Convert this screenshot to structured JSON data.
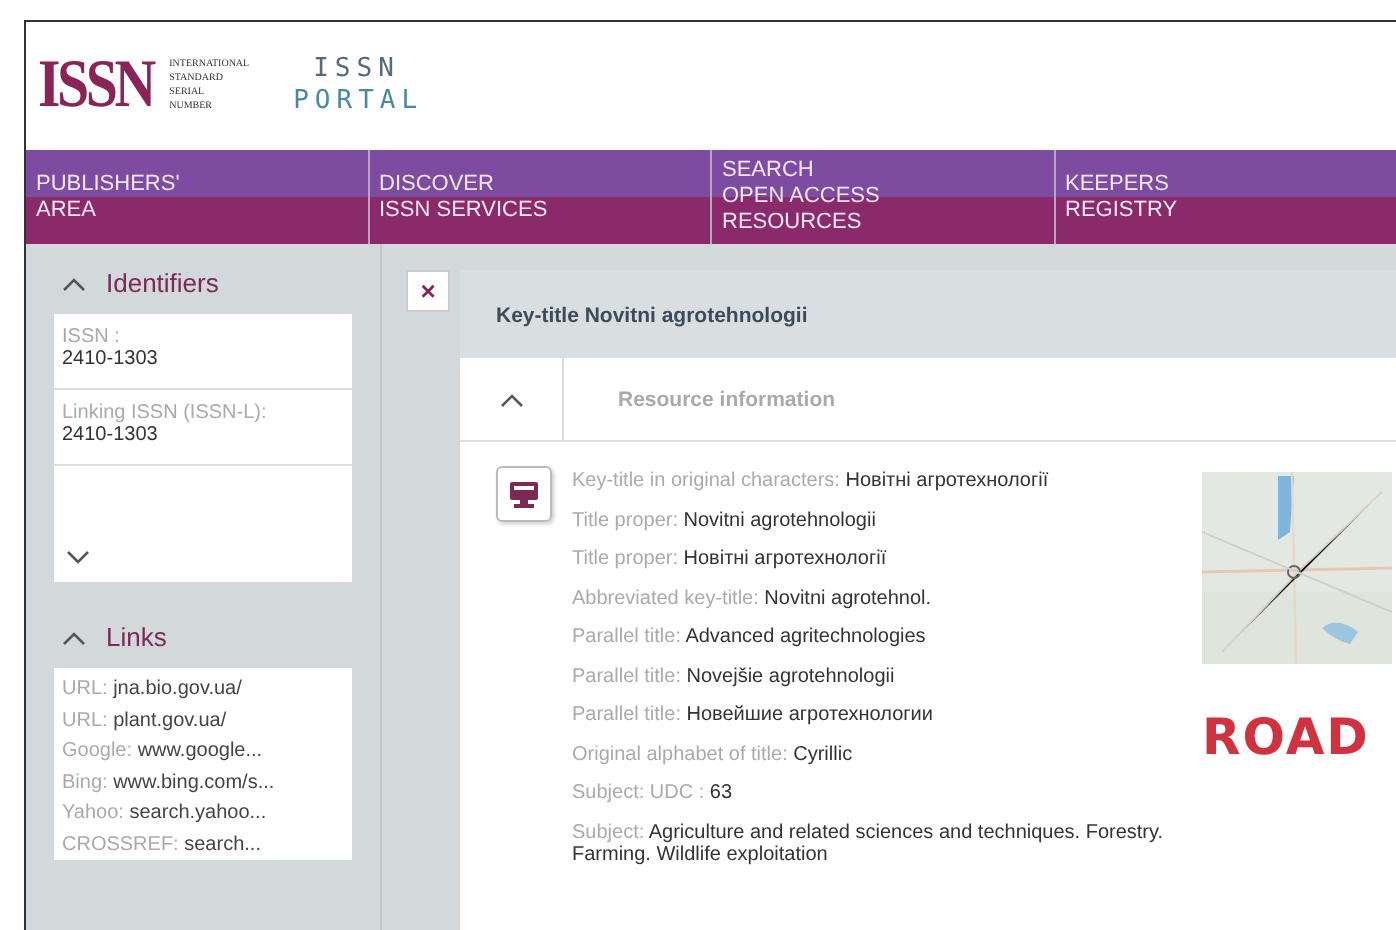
{
  "logo": {
    "mark": "ISSN",
    "words": [
      "INTERNATIONAL",
      "STANDARD",
      "SERIAL",
      "NUMBER"
    ]
  },
  "portal_logo": {
    "lines": [
      "ISSN",
      "PORTAL"
    ]
  },
  "nav": [
    {
      "lines": [
        "PUBLISHERS'",
        "AREA"
      ]
    },
    {
      "lines": [
        "DISCOVER",
        "ISSN SERVICES"
      ]
    },
    {
      "lines": [
        "SEARCH",
        "OPEN ACCESS",
        "RESOURCES"
      ]
    },
    {
      "lines": [
        "KEEPERS",
        "REGISTRY"
      ]
    }
  ],
  "sidebar": {
    "sections": [
      {
        "kind": "fields",
        "title": "Identifiers",
        "expanded": true,
        "fields": [
          {
            "label": "ISSN :",
            "value": "2410-1303"
          },
          {
            "label": "Linking ISSN (ISSN-L):",
            "value": "2410-1303"
          }
        ]
      },
      {
        "kind": "links",
        "title": "Links",
        "expanded": true,
        "links": [
          {
            "label": "URL:",
            "value": "jna.bio.gov.ua/"
          },
          {
            "label": "URL:",
            "value": "plant.gov.ua/"
          },
          {
            "label": "Google:",
            "value": "www.google..."
          },
          {
            "label": "Bing:",
            "value": "www.bing.com/s..."
          },
          {
            "label": "Yahoo:",
            "value": "search.yahoo..."
          },
          {
            "label": "CROSSREF:",
            "value": "search..."
          }
        ]
      }
    ]
  },
  "close": "×",
  "record": {
    "title": "Key-title Novitni agrotehnologii",
    "section": {
      "title": "Resource information",
      "expanded": true
    },
    "rows": [
      {
        "label": "Key-title in original characters:",
        "value": "Новітні агротехнології"
      },
      {
        "label": "Title proper:",
        "value": "Novitni agrotehnologii"
      },
      {
        "label": "Title proper:",
        "value": "Новітні агротехнології"
      },
      {
        "label": "Abbreviated key-title:",
        "value": "Novitni agrotehnol."
      },
      {
        "label": "Parallel title:",
        "value": "Advanced agritechnologies"
      },
      {
        "label": "Parallel title:",
        "value": "Novejšie agrotehnologii"
      },
      {
        "label": "Parallel title:",
        "value": "Новейшие агротехнологии"
      },
      {
        "label": "Original alphabet of title:",
        "value": "Cyrillic"
      },
      {
        "label": "Subject: UDC :",
        "value": "63"
      },
      {
        "label": "Subject:",
        "value": "Agriculture and related sciences and techniques. Forestry. Farming. Wildlife exploitation"
      }
    ],
    "road_logo": {
      "text": "ROAD"
    }
  }
}
